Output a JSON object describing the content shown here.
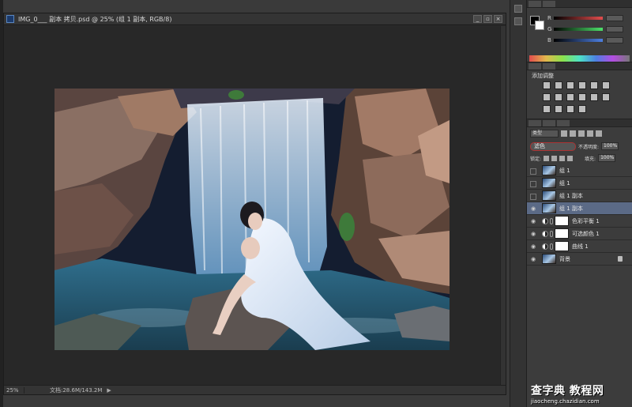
{
  "document": {
    "tab_title": "IMG_0___ 副本 拷贝.psd @ 25% (组 1 副本, RGB/8)",
    "controls": [
      "_",
      "▫",
      "×"
    ],
    "zoom": "25%",
    "doc_info": "文档:28.6M/143.2M"
  },
  "color_panel": {
    "channels": [
      {
        "label": "R",
        "color": "#e24d4d"
      },
      {
        "label": "G",
        "color": "#4de26a"
      },
      {
        "label": "B",
        "color": "#4d7fe2"
      }
    ]
  },
  "adjustments_panel": {
    "title": "添加调整"
  },
  "layers_panel": {
    "kind_filter": "类型",
    "blend_mode": "滤色",
    "opacity_label": "不透明度:",
    "opacity_value": "100%",
    "lock_label": "锁定:",
    "fill_label": "填充:",
    "fill_value": "100%",
    "layers": [
      {
        "name": "组 1",
        "visible": false,
        "type": "image",
        "selected": false
      },
      {
        "name": "组 1",
        "visible": false,
        "type": "image",
        "selected": false
      },
      {
        "name": "组 1 副本",
        "visible": false,
        "type": "image",
        "selected": false
      },
      {
        "name": "组 1 副本",
        "visible": true,
        "type": "image",
        "selected": true
      },
      {
        "name": "色彩平衡 1",
        "visible": true,
        "type": "adjustment",
        "selected": false
      },
      {
        "name": "可选颜色 1",
        "visible": true,
        "type": "adjustment",
        "selected": false
      },
      {
        "name": "曲线 1",
        "visible": true,
        "type": "adjustment",
        "selected": false
      },
      {
        "name": "背景",
        "visible": true,
        "type": "background",
        "selected": false
      }
    ]
  },
  "watermark": {
    "main": "查字典 教程网",
    "sub": "jiaocheng.chazidian.com"
  }
}
